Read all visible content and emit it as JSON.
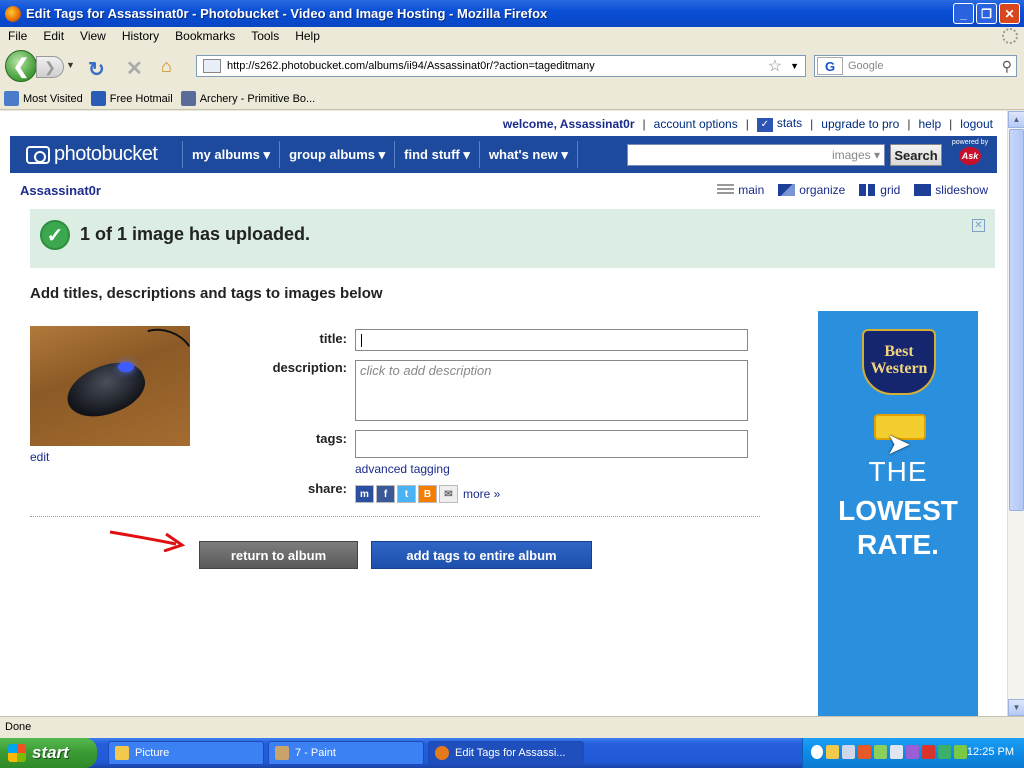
{
  "window": {
    "title": "Edit Tags for Assassinat0r - Photobucket - Video and Image Hosting - Mozilla Firefox",
    "buttons": {
      "minimize": "_",
      "maximize": "❐",
      "close": "✕"
    }
  },
  "menu": [
    "File",
    "Edit",
    "View",
    "History",
    "Bookmarks",
    "Tools",
    "Help"
  ],
  "nav": {
    "url": "http://s262.photobucket.com/albums/ii94/Assassinat0r/?action=tageditmany",
    "search_placeholder": "Google",
    "search_engine_letter": "G"
  },
  "bookmarks": [
    {
      "label": "Most Visited",
      "color": "#4a7cc9"
    },
    {
      "label": "Free Hotmail",
      "color": "#2b5cb5"
    },
    {
      "label": "Archery - Primitive Bo...",
      "color": "#5a6b9a"
    }
  ],
  "page": {
    "toplinks": {
      "welcome": "welcome, Assassinat0r",
      "account": "account options",
      "stats": "stats",
      "upgrade": "upgrade to pro",
      "help": "help",
      "logout": "logout"
    },
    "pbnav": {
      "logo": "photobucket",
      "menus": [
        "my albums ▾",
        "group albums ▾",
        "find stuff ▾",
        "what's new ▾"
      ],
      "search_scope": "images ▾",
      "search_button": "Search",
      "powered_by": "powered by",
      "ask": "Ask"
    },
    "username": "Assassinat0r",
    "views": [
      "main",
      "organize",
      "grid",
      "slideshow"
    ],
    "banner": {
      "message": "1 of 1 image has uploaded.",
      "close": "✕"
    },
    "heading": "Add titles, descriptions and tags to images below",
    "edit_link": "edit",
    "form": {
      "title_label": "title:",
      "description_label": "description:",
      "description_placeholder": "click to add description",
      "tags_label": "tags:",
      "advanced_tagging": "advanced tagging",
      "share_label": "share:",
      "more": "more »"
    },
    "buttons": {
      "return": "return to album",
      "add_tags": "add tags to entire album"
    },
    "ad": {
      "brand": "Best Western",
      "line1": "THE",
      "line2": "LOWEST RATE."
    }
  },
  "status": "Done",
  "taskbar": {
    "start": "start",
    "tasks": [
      "Picture",
      "7 - Paint",
      "Edit Tags for Assassi..."
    ],
    "clock": "12:25 PM"
  }
}
